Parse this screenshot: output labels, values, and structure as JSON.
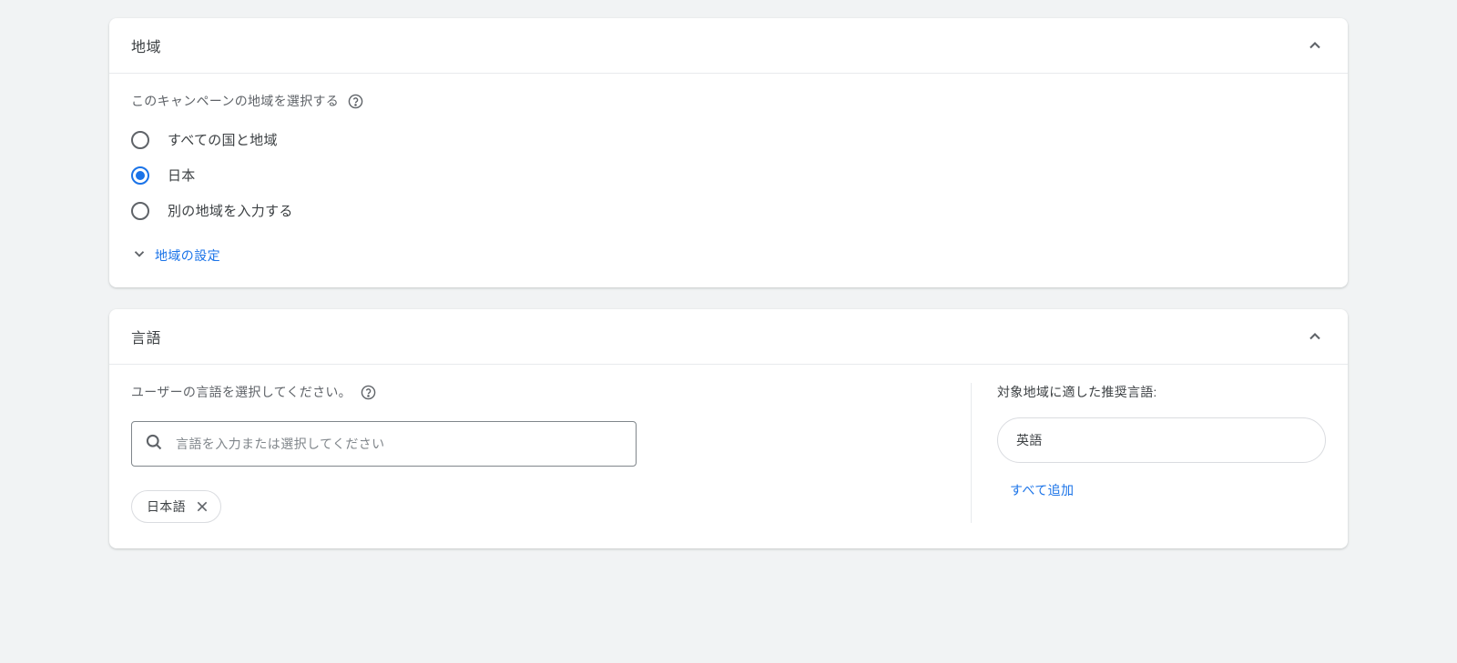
{
  "region": {
    "title": "地域",
    "subtitle": "このキャンペーンの地域を選択する",
    "options": {
      "all": "すべての国と地域",
      "japan": "日本",
      "other": "別の地域を入力する"
    },
    "settings_link": "地域の設定"
  },
  "language": {
    "title": "言語",
    "subtitle": "ユーザーの言語を選択してください。",
    "search_placeholder": "言語を入力または選択してください",
    "selected_chip": "日本語",
    "reco_label": "対象地域に適した推奨言語:",
    "reco_option": "英語",
    "add_all": "すべて追加"
  }
}
